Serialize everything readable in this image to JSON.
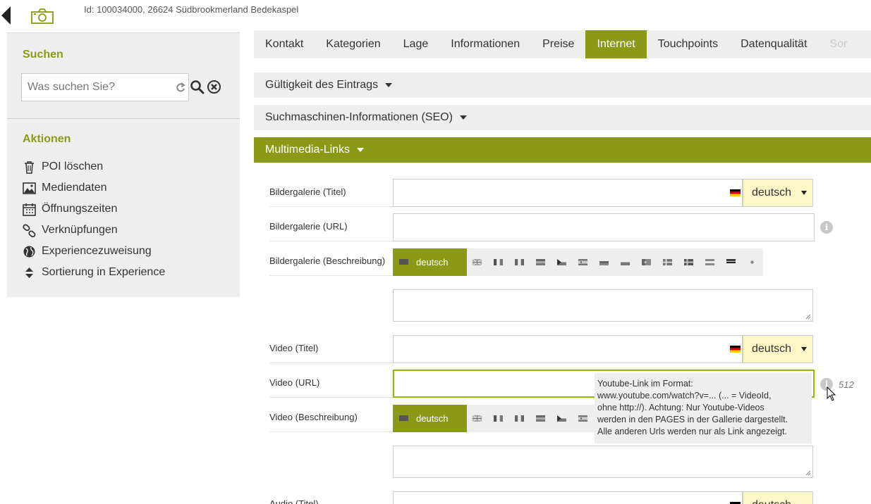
{
  "header": {
    "poi_id": "Id: 100034000, 26624 Südbrookmerland Bedekaspel"
  },
  "sidebar": {
    "search_title": "Suchen",
    "search_placeholder": "Was suchen Sie?",
    "actions_title": "Aktionen",
    "actions": [
      {
        "label": "POI löschen",
        "icon": "trash-icon"
      },
      {
        "label": "Mediendaten",
        "icon": "image-icon"
      },
      {
        "label": "Öffnungszeiten",
        "icon": "calendar-icon"
      },
      {
        "label": "Verknüpfungen",
        "icon": "link-icon"
      },
      {
        "label": "Experiencezuweisung",
        "icon": "globe-icon"
      },
      {
        "label": "Sortierung in Experience",
        "icon": "sort-icon"
      }
    ]
  },
  "tabs": [
    {
      "label": "Kontakt"
    },
    {
      "label": "Kategorien"
    },
    {
      "label": "Lage"
    },
    {
      "label": "Informationen"
    },
    {
      "label": "Preise"
    },
    {
      "label": "Internet",
      "active": true
    },
    {
      "label": "Touchpoints"
    },
    {
      "label": "Datenqualität"
    },
    {
      "label": "Sor"
    }
  ],
  "accordion": {
    "validity": "Gültigkeit des Eintrags",
    "seo": "Suchmaschinen-Informationen (SEO)",
    "multimedia": "Multimedia-Links"
  },
  "form": {
    "gallery_title": "Bildergalerie (Titel)",
    "gallery_url": "Bildergalerie (URL)",
    "gallery_desc": "Bildergalerie (Beschreibung)",
    "video_title": "Video (Titel)",
    "video_url": "Video (URL)",
    "video_desc": "Video (Beschreibung)",
    "audio_title": "Audio (Titel)",
    "language": "deutsch",
    "char_count": "512"
  },
  "tooltip": {
    "lines": [
      "Youtube-Link im Format:",
      "www.youtube.com/watch?v=... (... = VideoId,",
      "ohne http://). Achtung: Nur Youtube-Videos",
      "werden in den PAGES in der Gallerie dargestellt.",
      "Alle anderen Urls werden nur als Link angezeigt."
    ]
  },
  "colors": {
    "accent": "#8a9a17",
    "panel": "#eeeeee",
    "lang_select": "#fdf6c7"
  }
}
